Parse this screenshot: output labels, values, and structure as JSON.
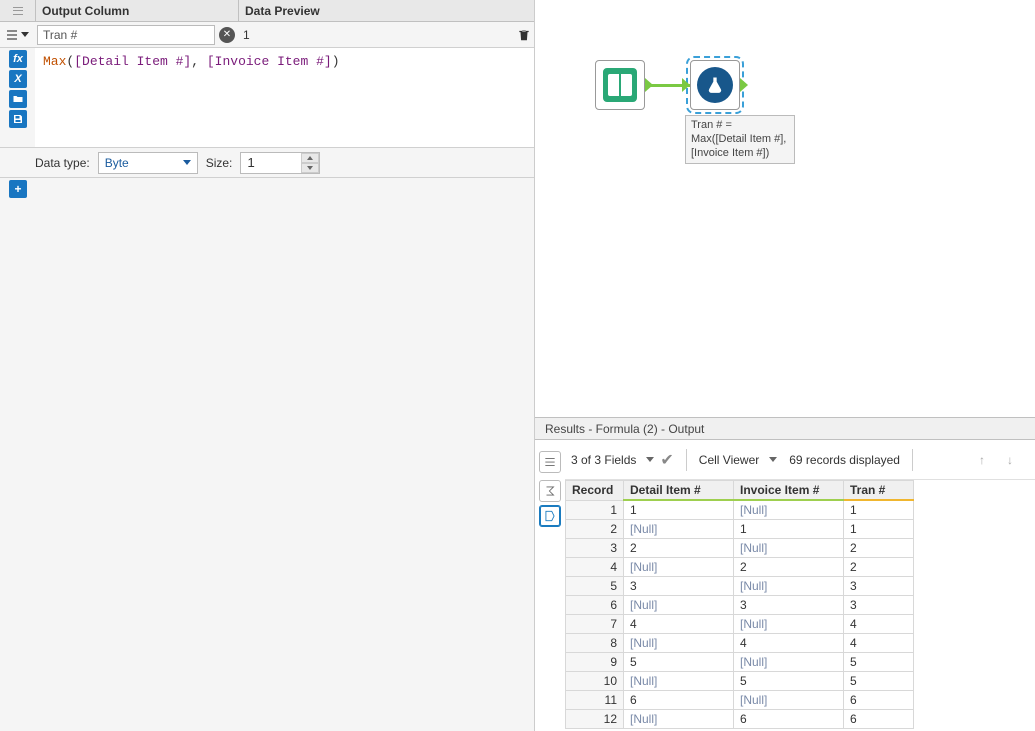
{
  "config": {
    "headers": {
      "output": "Output Column",
      "preview": "Data Preview"
    },
    "output_name": "Tran #",
    "preview_value": "1",
    "expression": {
      "fn": "Max",
      "field1": "[Detail Item #]",
      "field2": "[Invoice Item #]"
    },
    "datatype_label": "Data type:",
    "datatype_value": "Byte",
    "size_label": "Size:",
    "size_value": "1"
  },
  "canvas": {
    "annotation": "Tran # = Max([Detail Item #], [Invoice Item #])"
  },
  "results": {
    "title": "Results - Formula (2) - Output",
    "fields_text": "3 of 3 Fields",
    "cell_viewer_label": "Cell Viewer",
    "records_text": "69 records displayed",
    "columns": {
      "record": "Record",
      "detail": "Detail Item #",
      "invoice": "Invoice Item #",
      "tran": "Tran #"
    },
    "rows": [
      {
        "n": 1,
        "d": "1",
        "i": "[Null]",
        "t": "1"
      },
      {
        "n": 2,
        "d": "[Null]",
        "i": "1",
        "t": "1"
      },
      {
        "n": 3,
        "d": "2",
        "i": "[Null]",
        "t": "2"
      },
      {
        "n": 4,
        "d": "[Null]",
        "i": "2",
        "t": "2"
      },
      {
        "n": 5,
        "d": "3",
        "i": "[Null]",
        "t": "3"
      },
      {
        "n": 6,
        "d": "[Null]",
        "i": "3",
        "t": "3"
      },
      {
        "n": 7,
        "d": "4",
        "i": "[Null]",
        "t": "4"
      },
      {
        "n": 8,
        "d": "[Null]",
        "i": "4",
        "t": "4"
      },
      {
        "n": 9,
        "d": "5",
        "i": "[Null]",
        "t": "5"
      },
      {
        "n": 10,
        "d": "[Null]",
        "i": "5",
        "t": "5"
      },
      {
        "n": 11,
        "d": "6",
        "i": "[Null]",
        "t": "6"
      },
      {
        "n": 12,
        "d": "[Null]",
        "i": "6",
        "t": "6"
      }
    ]
  }
}
